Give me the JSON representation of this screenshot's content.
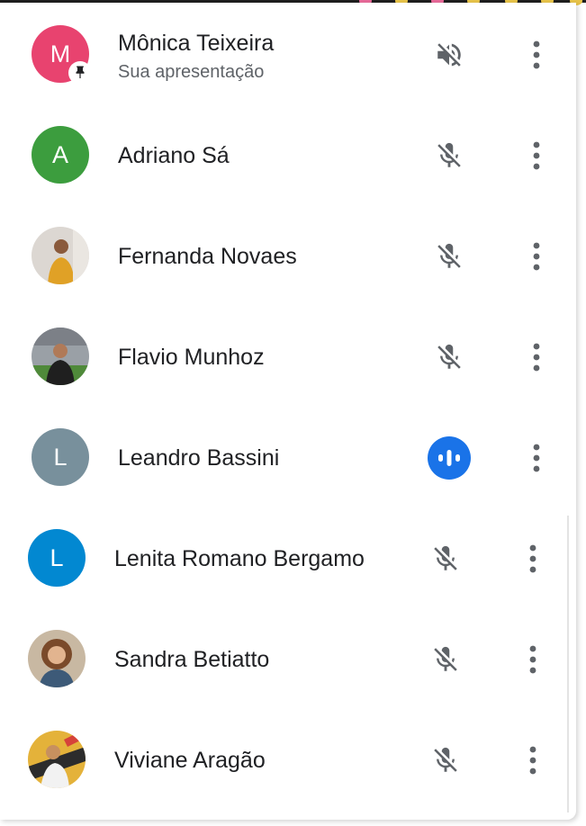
{
  "participants": [
    {
      "name": "Mônica Teixeira",
      "subtitle": "Sua apresentação",
      "initial": "M",
      "avatar_color": "#e8436f",
      "audio": "speaker-muted",
      "pinned": true
    },
    {
      "name": "Adriano Sá",
      "initial": "A",
      "avatar_color": "#3c9d3e",
      "audio": "mic-off"
    },
    {
      "name": "Fernanda Novaes",
      "initial": "",
      "avatar_color": "#d9d4cf",
      "audio": "mic-off"
    },
    {
      "name": "Flavio Munhoz",
      "initial": "",
      "avatar_color": "#6b7f56",
      "audio": "mic-off"
    },
    {
      "name": "Leandro Bassini",
      "initial": "L",
      "avatar_color": "#78909c",
      "audio": "speaking"
    },
    {
      "name": "Lenita Romano Bergamo",
      "initial": "L",
      "avatar_color": "#0288d1",
      "audio": "mic-off"
    },
    {
      "name": "Sandra Betiatto",
      "initial": "",
      "avatar_color": "#b89a7a",
      "audio": "mic-off"
    },
    {
      "name": "Viviane Aragão",
      "initial": "",
      "avatar_color": "#c99a3a",
      "audio": "mic-off"
    }
  ],
  "colors": {
    "accent": "#1a73e8",
    "icon": "#5f6368"
  },
  "icons": {
    "muted_speaker": "speaker-muted-icon",
    "mic_off": "mic-off-icon",
    "speaking": "audio-level-icon",
    "more": "more-vert-icon",
    "pin": "pin-icon"
  }
}
